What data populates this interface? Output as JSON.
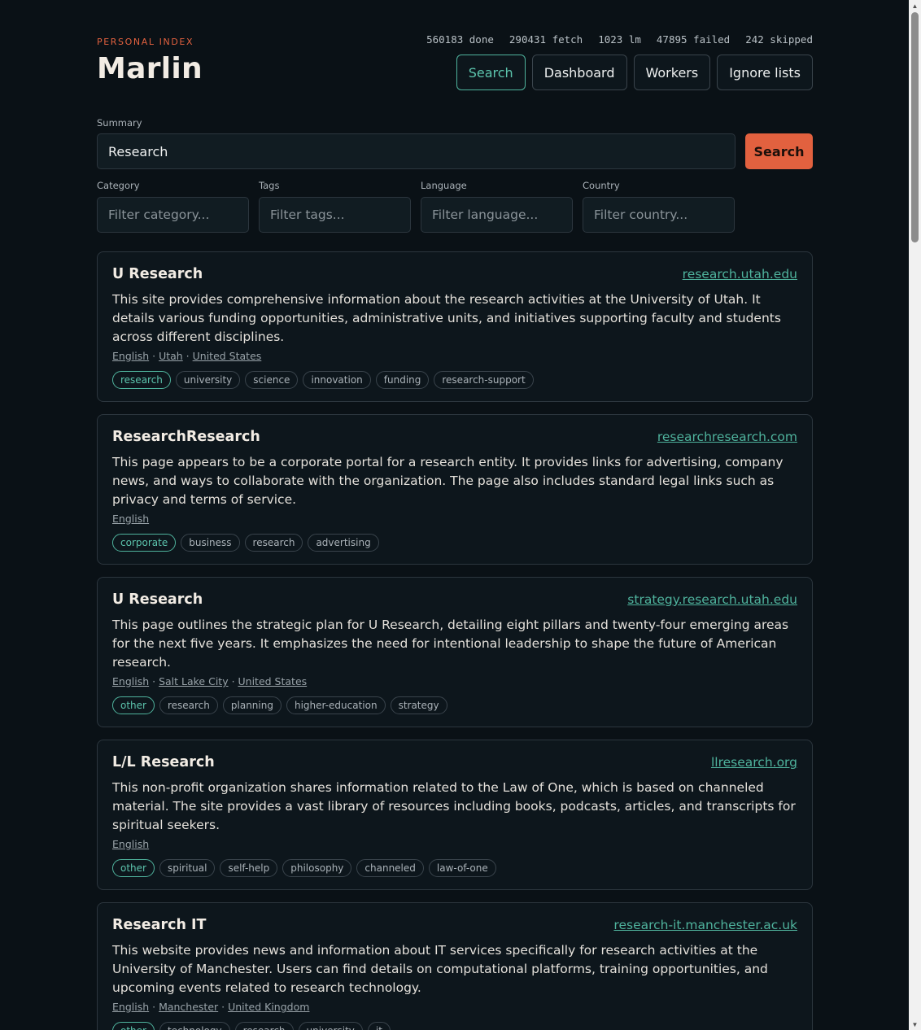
{
  "header": {
    "brand_label": "PERSONAL INDEX",
    "title": "Marlin",
    "stats": [
      "560183 done",
      "290431 fetch",
      "1023 lm",
      "47895 failed",
      "242 skipped"
    ],
    "nav": [
      "Search",
      "Dashboard",
      "Workers",
      "Ignore lists"
    ]
  },
  "search": {
    "summary_label": "Summary",
    "summary_value": "Research",
    "button": "Search",
    "filters": [
      {
        "label": "Category",
        "placeholder": "Filter category..."
      },
      {
        "label": "Tags",
        "placeholder": "Filter tags..."
      },
      {
        "label": "Language",
        "placeholder": "Filter language..."
      },
      {
        "label": "Country",
        "placeholder": "Filter country..."
      }
    ]
  },
  "results": [
    {
      "title": "U Research",
      "url": "research.utah.edu",
      "description": "This site provides comprehensive information about the research activities at the University of Utah. It details various funding opportunities, administrative units, and initiatives supporting faculty and students across different disciplines.",
      "meta": [
        "English",
        "Utah",
        "United States"
      ],
      "tags": [
        "research",
        "university",
        "science",
        "innovation",
        "funding",
        "research-support"
      ]
    },
    {
      "title": "ResearchResearch",
      "url": "researchresearch.com",
      "description": "This page appears to be a corporate portal for a research entity. It provides links for advertising, company news, and ways to collaborate with the organization. The page also includes standard legal links such as privacy and terms of service.",
      "meta": [
        "English"
      ],
      "tags": [
        "corporate",
        "business",
        "research",
        "advertising"
      ]
    },
    {
      "title": "U Research",
      "url": "strategy.research.utah.edu",
      "description": "This page outlines the strategic plan for U Research, detailing eight pillars and twenty-four emerging areas for the next five years. It emphasizes the need for intentional leadership to shape the future of American research.",
      "meta": [
        "English",
        "Salt Lake City",
        "United States"
      ],
      "tags": [
        "other",
        "research",
        "planning",
        "higher-education",
        "strategy"
      ]
    },
    {
      "title": "L/L Research",
      "url": "llresearch.org",
      "description": "This non-profit organization shares information related to the Law of One, which is based on channeled material. The site provides a vast library of resources including books, podcasts, articles, and transcripts for spiritual seekers.",
      "meta": [
        "English"
      ],
      "tags": [
        "other",
        "spiritual",
        "self-help",
        "philosophy",
        "channeled",
        "law-of-one"
      ]
    },
    {
      "title": "Research IT",
      "url": "research-it.manchester.ac.uk",
      "description": "This website provides news and information about IT services specifically for research activities at the University of Manchester. Users can find details on computational platforms, training opportunities, and upcoming events related to research technology.",
      "meta": [
        "English",
        "Manchester",
        "United Kingdom"
      ],
      "tags": [
        "other",
        "technology",
        "research",
        "university",
        "it"
      ]
    }
  ],
  "colors": {
    "accent": "#e2613f",
    "teal": "#4fb39d",
    "background": "#0a1116"
  }
}
